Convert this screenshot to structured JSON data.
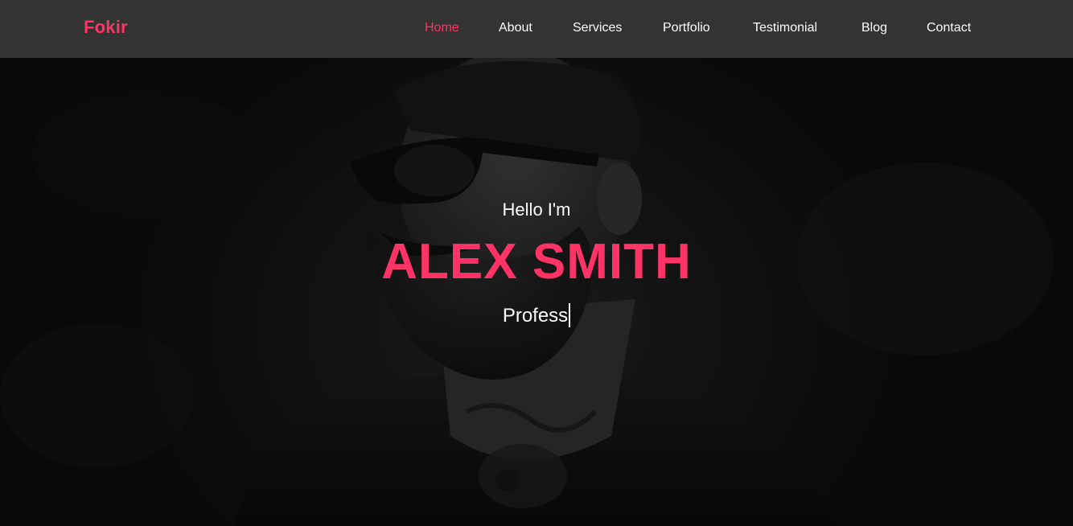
{
  "colors": {
    "accent": "#ff3366",
    "navbar_bg": "#333333",
    "nav_text": "#ffffff",
    "hero_text": "#ffffff"
  },
  "header": {
    "brand": "Fokir",
    "nav": [
      {
        "label": "Home",
        "active": true
      },
      {
        "label": "About",
        "active": false
      },
      {
        "label": "Services",
        "active": false
      },
      {
        "label": "Portfolio",
        "active": false
      },
      {
        "label": "Testimonial",
        "active": false
      },
      {
        "label": "Blog",
        "active": false
      },
      {
        "label": "Contact",
        "active": false
      }
    ]
  },
  "hero": {
    "greeting": "Hello I'm",
    "name": "ALEX SMITH",
    "typed_text": "Profess",
    "background": "portrait-photo"
  }
}
